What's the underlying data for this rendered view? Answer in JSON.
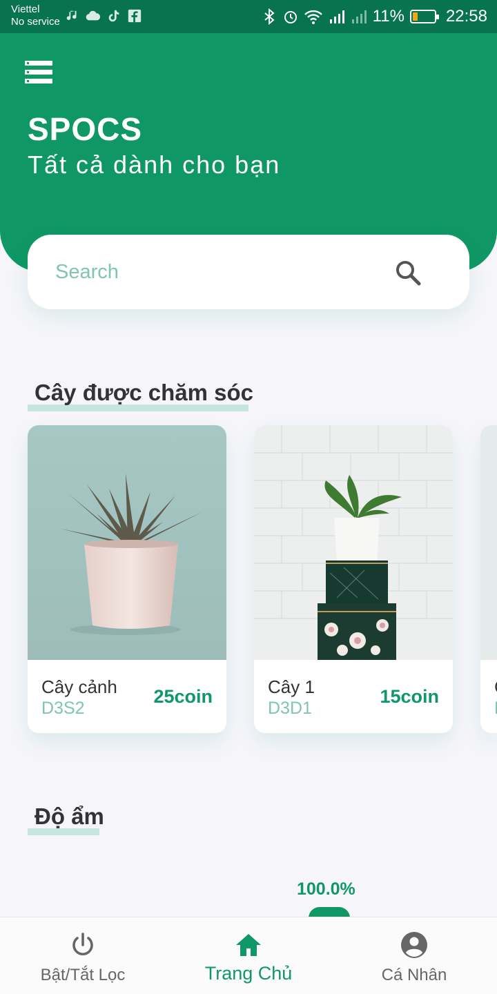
{
  "status_bar": {
    "carrier": "Viettel",
    "network": "No service",
    "battery": "11%",
    "time": "22:58"
  },
  "header": {
    "title": "SPOCS",
    "subtitle": "Tất cả dành cho bạn"
  },
  "search": {
    "placeholder": "Search"
  },
  "plants_section": {
    "title": "Cây được chăm sóc",
    "cards": [
      {
        "name": "Cây cảnh",
        "code": "D3S2",
        "price": "25coin"
      },
      {
        "name": "Cây 1",
        "code": "D3D1",
        "price": "15coin"
      },
      {
        "name": "C",
        "code": "D",
        "price": ""
      }
    ]
  },
  "humidity_section": {
    "title": "Độ ẩm",
    "value_label": "100.0%",
    "value": 100.0
  },
  "bottom_nav": {
    "items": [
      {
        "label": "Bật/Tắt Lọc",
        "icon": "power-icon"
      },
      {
        "label": "Trang Chủ",
        "icon": "home-icon"
      },
      {
        "label": "Cá Nhân",
        "icon": "account-icon"
      }
    ],
    "active_index": 1
  },
  "colors": {
    "primary": "#0f9866",
    "status_bar": "#07744f",
    "accent_light": "#7fc6ae",
    "underline": "#c6e5dc",
    "background": "#f5f5fa"
  }
}
